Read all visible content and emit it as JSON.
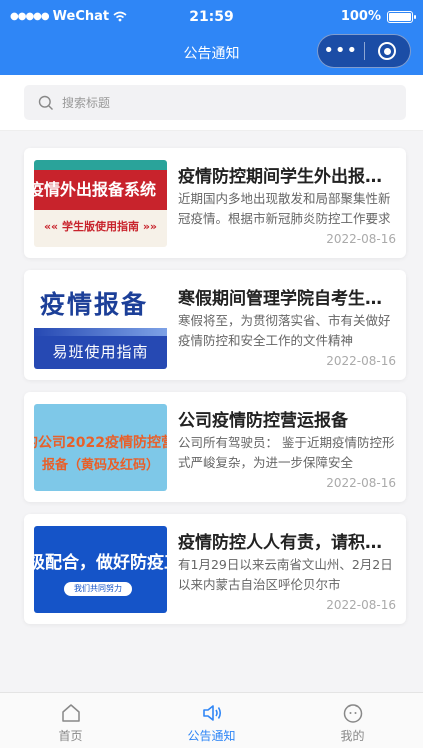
{
  "status_bar": {
    "signal_dots": "●●●●●",
    "carrier": "WeChat",
    "time": "21:59",
    "battery": "100%"
  },
  "header": {
    "title": "公告通知",
    "menu_label": "•••"
  },
  "search": {
    "placeholder": "搜索标题"
  },
  "articles": [
    {
      "title": "疫情防控期间学生外出报备系统使用指南",
      "summary": "近期国内多地出现散发和局部聚集性新冠疫情。根据市新冠肺炎防控工作要求",
      "date": "2022-08-16",
      "thumb": {
        "line1": "疫情外出报备系统",
        "line2": "«« 学生版使用指南 »»"
      }
    },
    {
      "title": "寒假期间管理学院自考生疫情防控工作",
      "summary": "寒假将至，为贯彻落实省、市有关做好疫情防控和安全工作的文件精神",
      "date": "2022-08-16",
      "thumb": {
        "line1": "疫情报备",
        "line2": "易班使用指南"
      }
    },
    {
      "title": "公司疫情防控营运报备",
      "summary": "公司所有驾驶员： 鉴于近期疫情防控形式严峻复杂，为进一步保障安全",
      "date": "2022-08-16",
      "thumb": {
        "line1": "的公司2022疫情防控营",
        "line2": "报备（黄码及红码）"
      }
    },
    {
      "title": "疫情防控人人有责，请积极配合",
      "summary": "有1月29日以来云南省文山州、2月2日以来内蒙古自治区呼伦贝尔市",
      "date": "2022-08-16",
      "thumb": {
        "line1": "极配合，做好防疫工",
        "line2": "我们共同努力"
      }
    }
  ],
  "tabbar": [
    {
      "label": "首页",
      "icon": "home-icon"
    },
    {
      "label": "公告通知",
      "icon": "speaker-icon"
    },
    {
      "label": "我的",
      "icon": "profile-face-icon"
    }
  ],
  "colors": {
    "primary": "#2f86f6",
    "capsule": "#1b4da6",
    "date": "#aaaaaa"
  }
}
